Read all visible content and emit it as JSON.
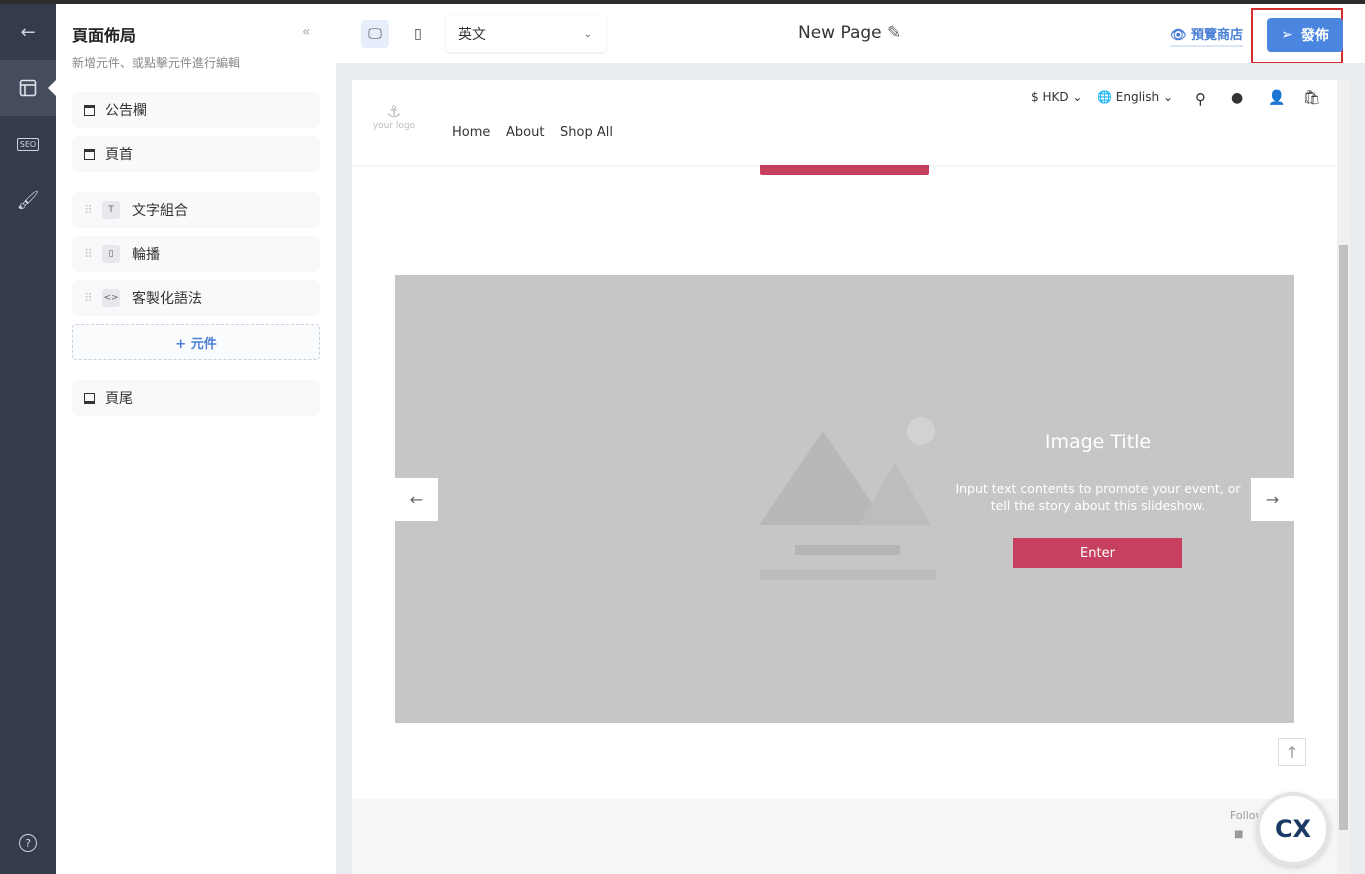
{
  "rail": {
    "back_icon": "arrow-left-icon",
    "items": [
      "layout-icon",
      "seo-icon",
      "paint-roller-icon"
    ],
    "help_icon": "question-circle-icon",
    "seo_label": "SEO"
  },
  "panel": {
    "title": "頁面佈局",
    "subtitle": "新增元件、或點擊元件進行編輯",
    "collapse": "«",
    "fixed_top": [
      {
        "label": "公告欄"
      },
      {
        "label": "頁首"
      }
    ],
    "components": [
      {
        "label": "文字組合",
        "icon": "text-icon"
      },
      {
        "label": "輪播",
        "icon": "carousel-icon"
      },
      {
        "label": "客製化語法",
        "icon": "code-icon"
      }
    ],
    "add_label": "+ 元件",
    "footer": {
      "label": "頁尾"
    }
  },
  "topbar": {
    "language": "英文",
    "page_title": "New Page",
    "preview_label": "預覽商店",
    "publish_label": "發佈",
    "accent": "#4a86e0"
  },
  "site": {
    "logo_text": "your logo",
    "nav": [
      "Home",
      "About",
      "Shop All"
    ],
    "currency": "$ HKD",
    "language": "English",
    "slide": {
      "title": "Image Title",
      "text": "Input text contents to promote your event, or tell the story about this slideshow.",
      "button": "Enter",
      "button_color": "#c8405f"
    },
    "footer": {
      "follow": "Follow"
    }
  },
  "chat_widget": {
    "label": "CX"
  }
}
